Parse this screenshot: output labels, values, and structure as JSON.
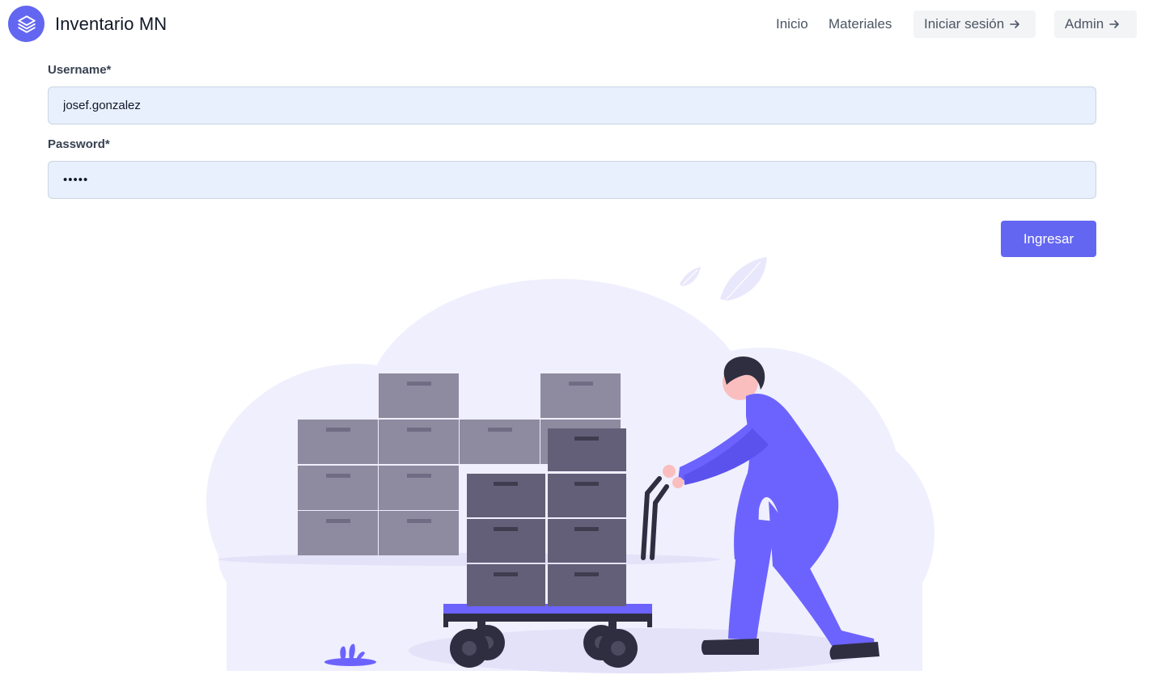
{
  "app": {
    "title": "Inventario MN",
    "logo_icon": "layers-icon"
  },
  "nav": {
    "inicio": "Inicio",
    "materiales": "Materiales",
    "login": "Iniciar sesión",
    "admin": "Admin"
  },
  "form": {
    "username_label": "Username*",
    "username_value": "josef.gonzalez",
    "password_label": "Password*",
    "password_value": "•••••",
    "submit_label": "Ingresar"
  },
  "illustration": {
    "subject": "warehouse worker pushing cart of boxes"
  },
  "colors": {
    "accent": "#6366f1",
    "input_bg": "#e8f0fe",
    "cloud": "#f0effe",
    "box_light": "#8e8a9f",
    "box_dark": "#645f78"
  }
}
